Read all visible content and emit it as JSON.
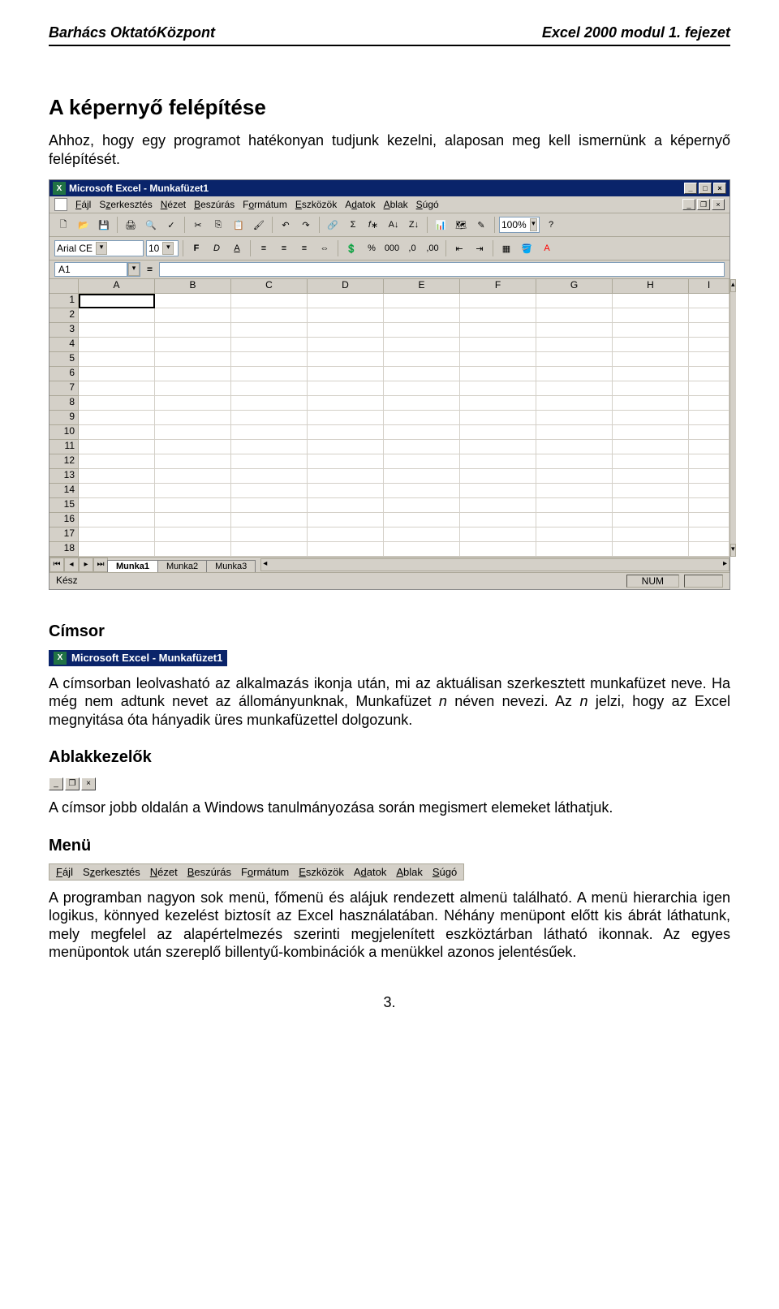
{
  "header": {
    "left": "Barhács OktatóKözpont",
    "right": "Excel 2000 modul 1. fejezet"
  },
  "section1": {
    "title": "A képernyő felépítése",
    "para": "Ahhoz, hogy egy programot hatékonyan tudjunk kezelni, alaposan meg kell ismernünk a képernyő felépítését."
  },
  "excel": {
    "title": "Microsoft Excel - Munkafüzet1",
    "menus": [
      "Fájl",
      "Szerkesztés",
      "Nézet",
      "Beszúrás",
      "Formátum",
      "Eszközök",
      "Adatok",
      "Ablak",
      "Súgó"
    ],
    "font": "Arial CE",
    "fontsize": "10",
    "zoom": "100%",
    "namebox": "A1",
    "cols": [
      "A",
      "B",
      "C",
      "D",
      "E",
      "F",
      "G",
      "H",
      "I"
    ],
    "rows": [
      "1",
      "2",
      "3",
      "4",
      "5",
      "6",
      "7",
      "8",
      "9",
      "10",
      "11",
      "12",
      "13",
      "14",
      "15",
      "16",
      "17",
      "18"
    ],
    "sheets": [
      "Munka1",
      "Munka2",
      "Munka3"
    ],
    "status": "Kész",
    "numlabel": "NUM"
  },
  "section2": {
    "title": "Címsor",
    "minititle": "Microsoft Excel - Munkafüzet1",
    "para": "A címsorban leolvasható az alkalmazás ikonja után, mi az aktuálisan szerkesztett munkafüzet neve. Ha még nem adtunk nevet az állományunknak, Munkafüzet n néven nevezi. Az n jelzi, hogy az Excel megnyitása óta hányadik üres munkafüzettel dolgozunk."
  },
  "section3": {
    "title": "Ablakkezelők",
    "para": "A címsor jobb oldalán a Windows tanulmányozása során megismert elemeket láthatjuk."
  },
  "section4": {
    "title": "Menü",
    "menus": [
      "Fájl",
      "Szerkesztés",
      "Nézet",
      "Beszúrás",
      "Formátum",
      "Eszközök",
      "Adatok",
      "Ablak",
      "Súgó"
    ],
    "para": "A programban nagyon sok menü, főmenü és alájuk rendezett almenü található. A menü hierarchia igen logikus, könnyed kezelést biztosít az Excel használatában. Néhány menüpont előtt kis ábrát láthatunk, mely megfelel az alapértelmezés szerinti megjelenített eszköztárban látható ikonnak. Az egyes menüpontok után szereplő billentyű-kombinációk a menükkel azonos jelentésűek."
  },
  "pagenum": "3."
}
